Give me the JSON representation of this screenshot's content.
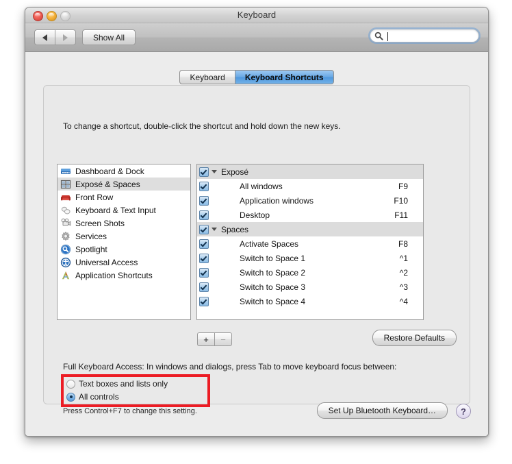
{
  "window": {
    "title": "Keyboard",
    "traffic": {
      "close": "close-button",
      "minimize": "minimize-button",
      "zoom": "zoom-button"
    }
  },
  "toolbar": {
    "back_label": "◀",
    "forward_label": "▶",
    "show_all_label": "Show All",
    "search": {
      "value": "",
      "placeholder": ""
    }
  },
  "tabs": [
    {
      "label": "Keyboard",
      "active": false
    },
    {
      "label": "Keyboard Shortcuts",
      "active": true
    }
  ],
  "main": {
    "instruction": "To change a shortcut, double-click the shortcut and hold down the new keys.",
    "sidebar": [
      {
        "label": "Dashboard & Dock",
        "icon": "dashboard-dock-icon",
        "selected": false
      },
      {
        "label": "Exposé & Spaces",
        "icon": "expose-spaces-icon",
        "selected": true
      },
      {
        "label": "Front Row",
        "icon": "front-row-icon",
        "selected": false
      },
      {
        "label": "Keyboard & Text Input",
        "icon": "keyboard-text-input-icon",
        "selected": false
      },
      {
        "label": "Screen Shots",
        "icon": "screen-shots-icon",
        "selected": false
      },
      {
        "label": "Services",
        "icon": "services-gear-icon",
        "selected": false
      },
      {
        "label": "Spotlight",
        "icon": "spotlight-icon",
        "selected": false
      },
      {
        "label": "Universal Access",
        "icon": "universal-access-icon",
        "selected": false
      },
      {
        "label": "Application Shortcuts",
        "icon": "application-shortcuts-icon",
        "selected": false
      }
    ],
    "shortcuts": [
      {
        "label": "Exposé",
        "key": "",
        "group": true,
        "checked": true
      },
      {
        "label": "All windows",
        "key": "F9",
        "group": false,
        "checked": true
      },
      {
        "label": "Application windows",
        "key": "F10",
        "group": false,
        "checked": true
      },
      {
        "label": "Desktop",
        "key": "F11",
        "group": false,
        "checked": true
      },
      {
        "label": "Spaces",
        "key": "",
        "group": true,
        "checked": true
      },
      {
        "label": "Activate Spaces",
        "key": "F8",
        "group": false,
        "checked": true
      },
      {
        "label": "Switch to Space 1",
        "key": "^1",
        "group": false,
        "checked": true
      },
      {
        "label": "Switch to Space 2",
        "key": "^2",
        "group": false,
        "checked": true
      },
      {
        "label": "Switch to Space 3",
        "key": "^3",
        "group": false,
        "checked": true
      },
      {
        "label": "Switch to Space 4",
        "key": "^4",
        "group": false,
        "checked": true
      }
    ],
    "add_label": "+",
    "remove_label": "−",
    "restore_defaults_label": "Restore Defaults",
    "full_keyboard_access_label": "Full Keyboard Access: In windows and dialogs, press Tab to move keyboard focus between:",
    "radio_options": [
      {
        "label": "Text boxes and lists only",
        "selected": false
      },
      {
        "label": "All controls",
        "selected": true
      }
    ],
    "hint": "Press Control+F7 to change this setting."
  },
  "footer": {
    "bluetooth_label": "Set Up Bluetooth Keyboard…",
    "help_label": "?"
  },
  "annotation": {
    "color": "#ec1c24"
  }
}
